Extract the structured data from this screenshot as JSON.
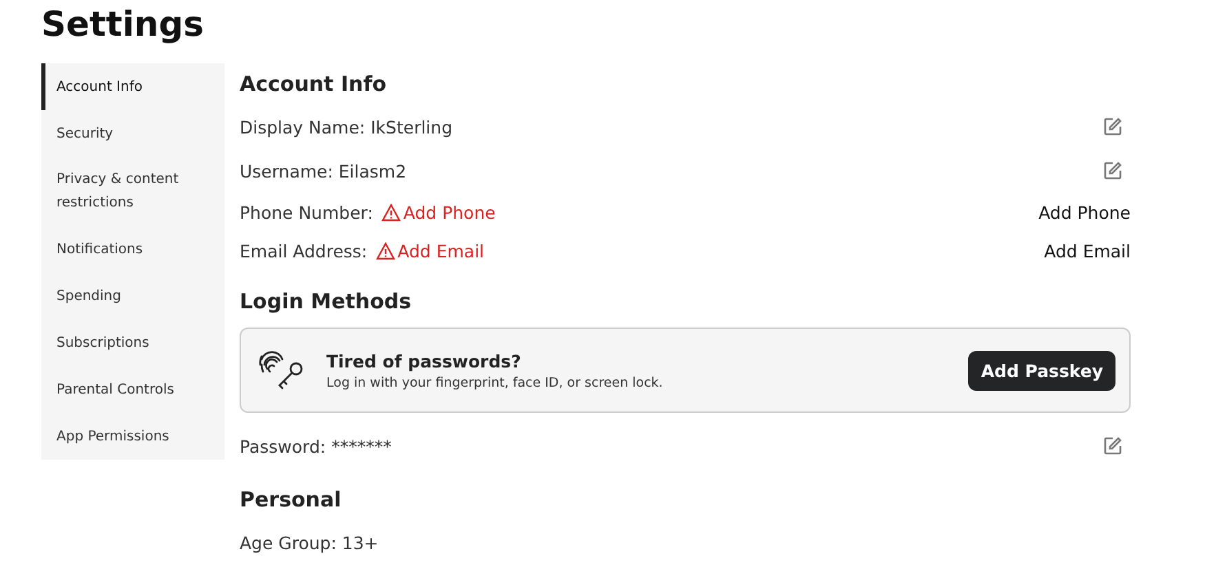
{
  "title": "Settings",
  "sidebar": {
    "items": [
      {
        "label": "Account Info",
        "selected": true
      },
      {
        "label": "Security",
        "selected": false
      },
      {
        "label": "Privacy & content restrictions",
        "selected": false
      },
      {
        "label": "Notifications",
        "selected": false
      },
      {
        "label": "Spending",
        "selected": false
      },
      {
        "label": "Subscriptions",
        "selected": false
      },
      {
        "label": "Parental Controls",
        "selected": false
      },
      {
        "label": "App Permissions",
        "selected": false
      }
    ]
  },
  "sections": [
    {
      "heading": "Account Info",
      "rows": [
        {
          "kind": "editable",
          "text": "Display Name: IkSterling"
        },
        {
          "kind": "editable",
          "text": "Username: Eilasm2"
        },
        {
          "kind": "missing",
          "label": "Phone Number:",
          "warning": "Add Phone",
          "action": "Add Phone"
        },
        {
          "kind": "missing",
          "label": "Email Address:",
          "warning": "Add Email",
          "action": "Add Email"
        }
      ]
    },
    {
      "heading": "Login Methods",
      "rows": [
        {
          "kind": "passkey",
          "title": "Tired of passwords?",
          "text": "Log in with your fingerprint, face ID, or screen lock.",
          "button": "Add Passkey"
        },
        {
          "kind": "editable",
          "text": "Password: *******"
        }
      ]
    },
    {
      "heading": "Personal",
      "rows": [
        {
          "kind": "plain",
          "text": "Age Group: 13+"
        }
      ]
    }
  ]
}
